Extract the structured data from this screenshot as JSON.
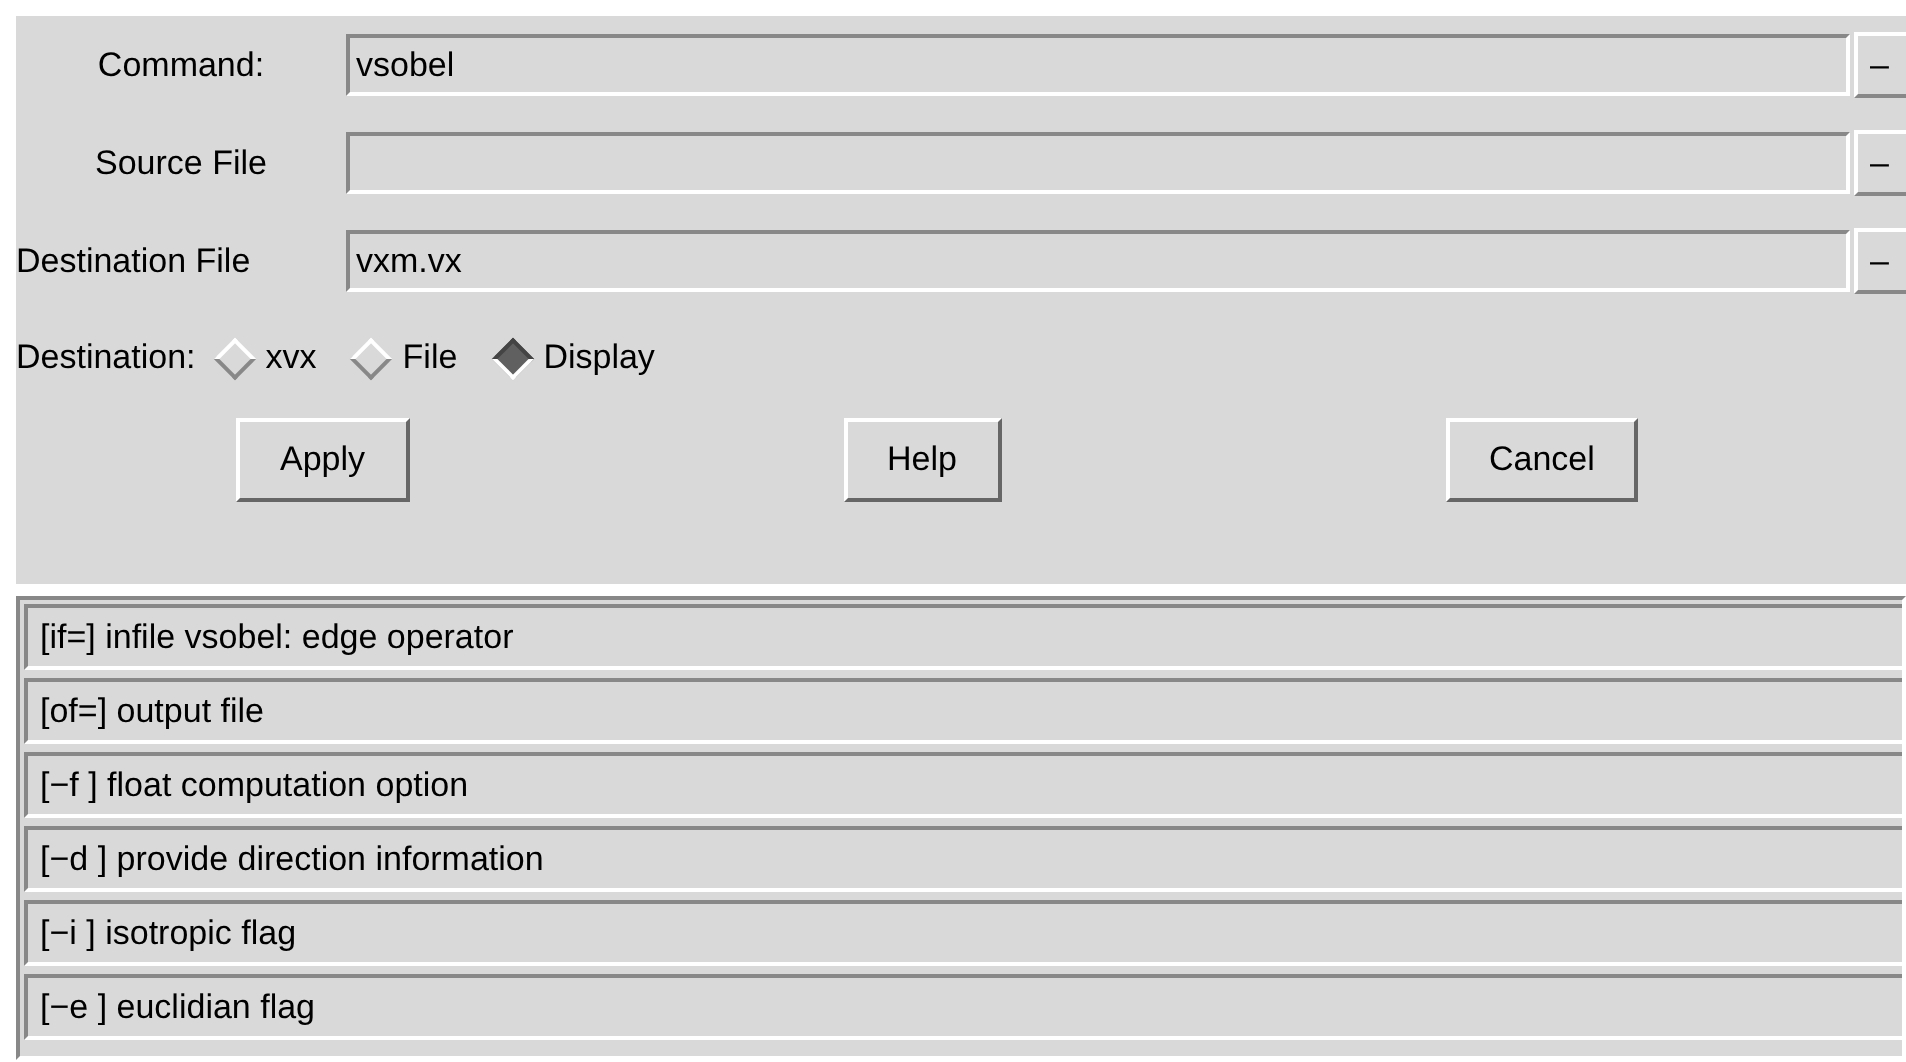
{
  "fields": [
    {
      "label": "Command:",
      "value": "vsobel",
      "button": "–"
    },
    {
      "label": "Source File",
      "button": "–"
    },
    {
      "label": "Destination File",
      "value": "vxm.vx",
      "button": "–"
    }
  ],
  "destination": {
    "label": "Destination:",
    "options": [
      {
        "label": "xvx",
        "selected": false
      },
      {
        "label": "File",
        "selected": false
      },
      {
        "label": "Display",
        "selected": true
      }
    ]
  },
  "buttons": [
    "Apply",
    "Help",
    "Cancel"
  ],
  "options": [
    "[if=] infile vsobel: edge operator",
    "[of=] output file",
    "[−f ] float computation option",
    "[−d ] provide direction information",
    "[−i ] isotropic flag",
    "[−e ] euclidian flag"
  ]
}
